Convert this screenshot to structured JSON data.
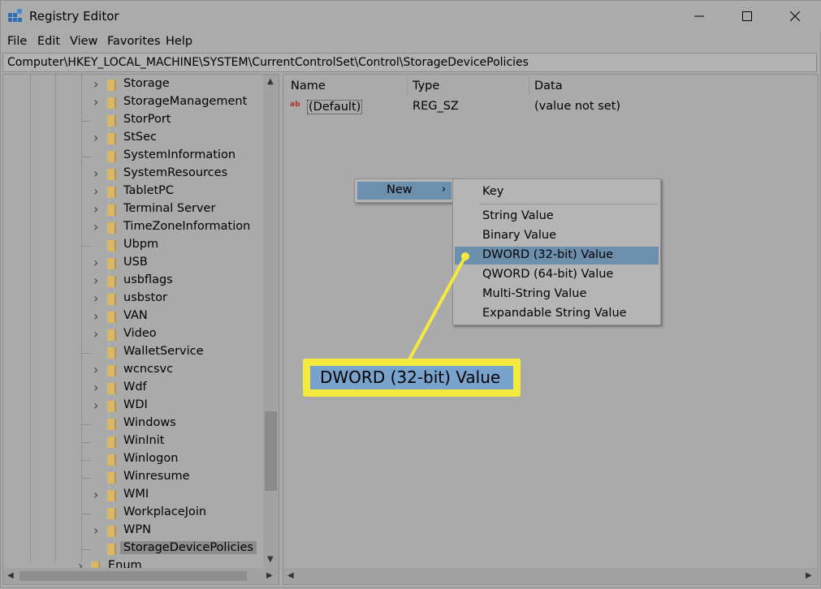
{
  "window": {
    "title": "Registry Editor",
    "buttons": {
      "minimize": "—",
      "maximize": "☐",
      "close": "✕"
    }
  },
  "menubar": {
    "items": [
      "File",
      "Edit",
      "View",
      "Favorites",
      "Help"
    ]
  },
  "address": {
    "path": "Computer\\HKEY_LOCAL_MACHINE\\SYSTEM\\CurrentControlSet\\Control\\StorageDevicePolicies"
  },
  "tree": {
    "items": [
      {
        "label": "Storage",
        "expandable": true
      },
      {
        "label": "StorageManagement",
        "expandable": true
      },
      {
        "label": "StorPort",
        "expandable": false
      },
      {
        "label": "StSec",
        "expandable": true
      },
      {
        "label": "SystemInformation",
        "expandable": false
      },
      {
        "label": "SystemResources",
        "expandable": true
      },
      {
        "label": "TabletPC",
        "expandable": true
      },
      {
        "label": "Terminal Server",
        "expandable": true
      },
      {
        "label": "TimeZoneInformation",
        "expandable": true
      },
      {
        "label": "Ubpm",
        "expandable": false
      },
      {
        "label": "USB",
        "expandable": true
      },
      {
        "label": "usbflags",
        "expandable": true
      },
      {
        "label": "usbstor",
        "expandable": true
      },
      {
        "label": "VAN",
        "expandable": true
      },
      {
        "label": "Video",
        "expandable": true
      },
      {
        "label": "WalletService",
        "expandable": false
      },
      {
        "label": "wcncsvc",
        "expandable": true
      },
      {
        "label": "Wdf",
        "expandable": true
      },
      {
        "label": "WDI",
        "expandable": true
      },
      {
        "label": "Windows",
        "expandable": false
      },
      {
        "label": "WinInit",
        "expandable": false
      },
      {
        "label": "Winlogon",
        "expandable": false
      },
      {
        "label": "Winresume",
        "expandable": false
      },
      {
        "label": "WMI",
        "expandable": true
      },
      {
        "label": "WorkplaceJoin",
        "expandable": false
      },
      {
        "label": "WPN",
        "expandable": true
      },
      {
        "label": "StorageDevicePolicies",
        "expandable": false,
        "selected": true
      },
      {
        "label": "Enum",
        "expandable": true,
        "parent_level": true
      }
    ]
  },
  "list": {
    "columns": [
      "Name",
      "Type",
      "Data"
    ],
    "rows": [
      {
        "icon": "string-value-icon",
        "icon_text": "ab",
        "name": "(Default)",
        "type": "REG_SZ",
        "data": "(value not set)"
      }
    ]
  },
  "context_menu": {
    "new_label": "New",
    "new_chevron": "›",
    "submenu": {
      "key": "Key",
      "items": [
        "String Value",
        "Binary Value",
        "DWORD (32-bit) Value",
        "QWORD (64-bit) Value",
        "Multi-String Value",
        "Expandable String Value"
      ],
      "highlighted": "DWORD (32-bit) Value"
    }
  },
  "callout": {
    "text": "DWORD (32-bit) Value",
    "color": "#f4ea3e"
  },
  "colors": {
    "highlight": "#6d8fae",
    "callout_inner": "#77a3cc"
  }
}
